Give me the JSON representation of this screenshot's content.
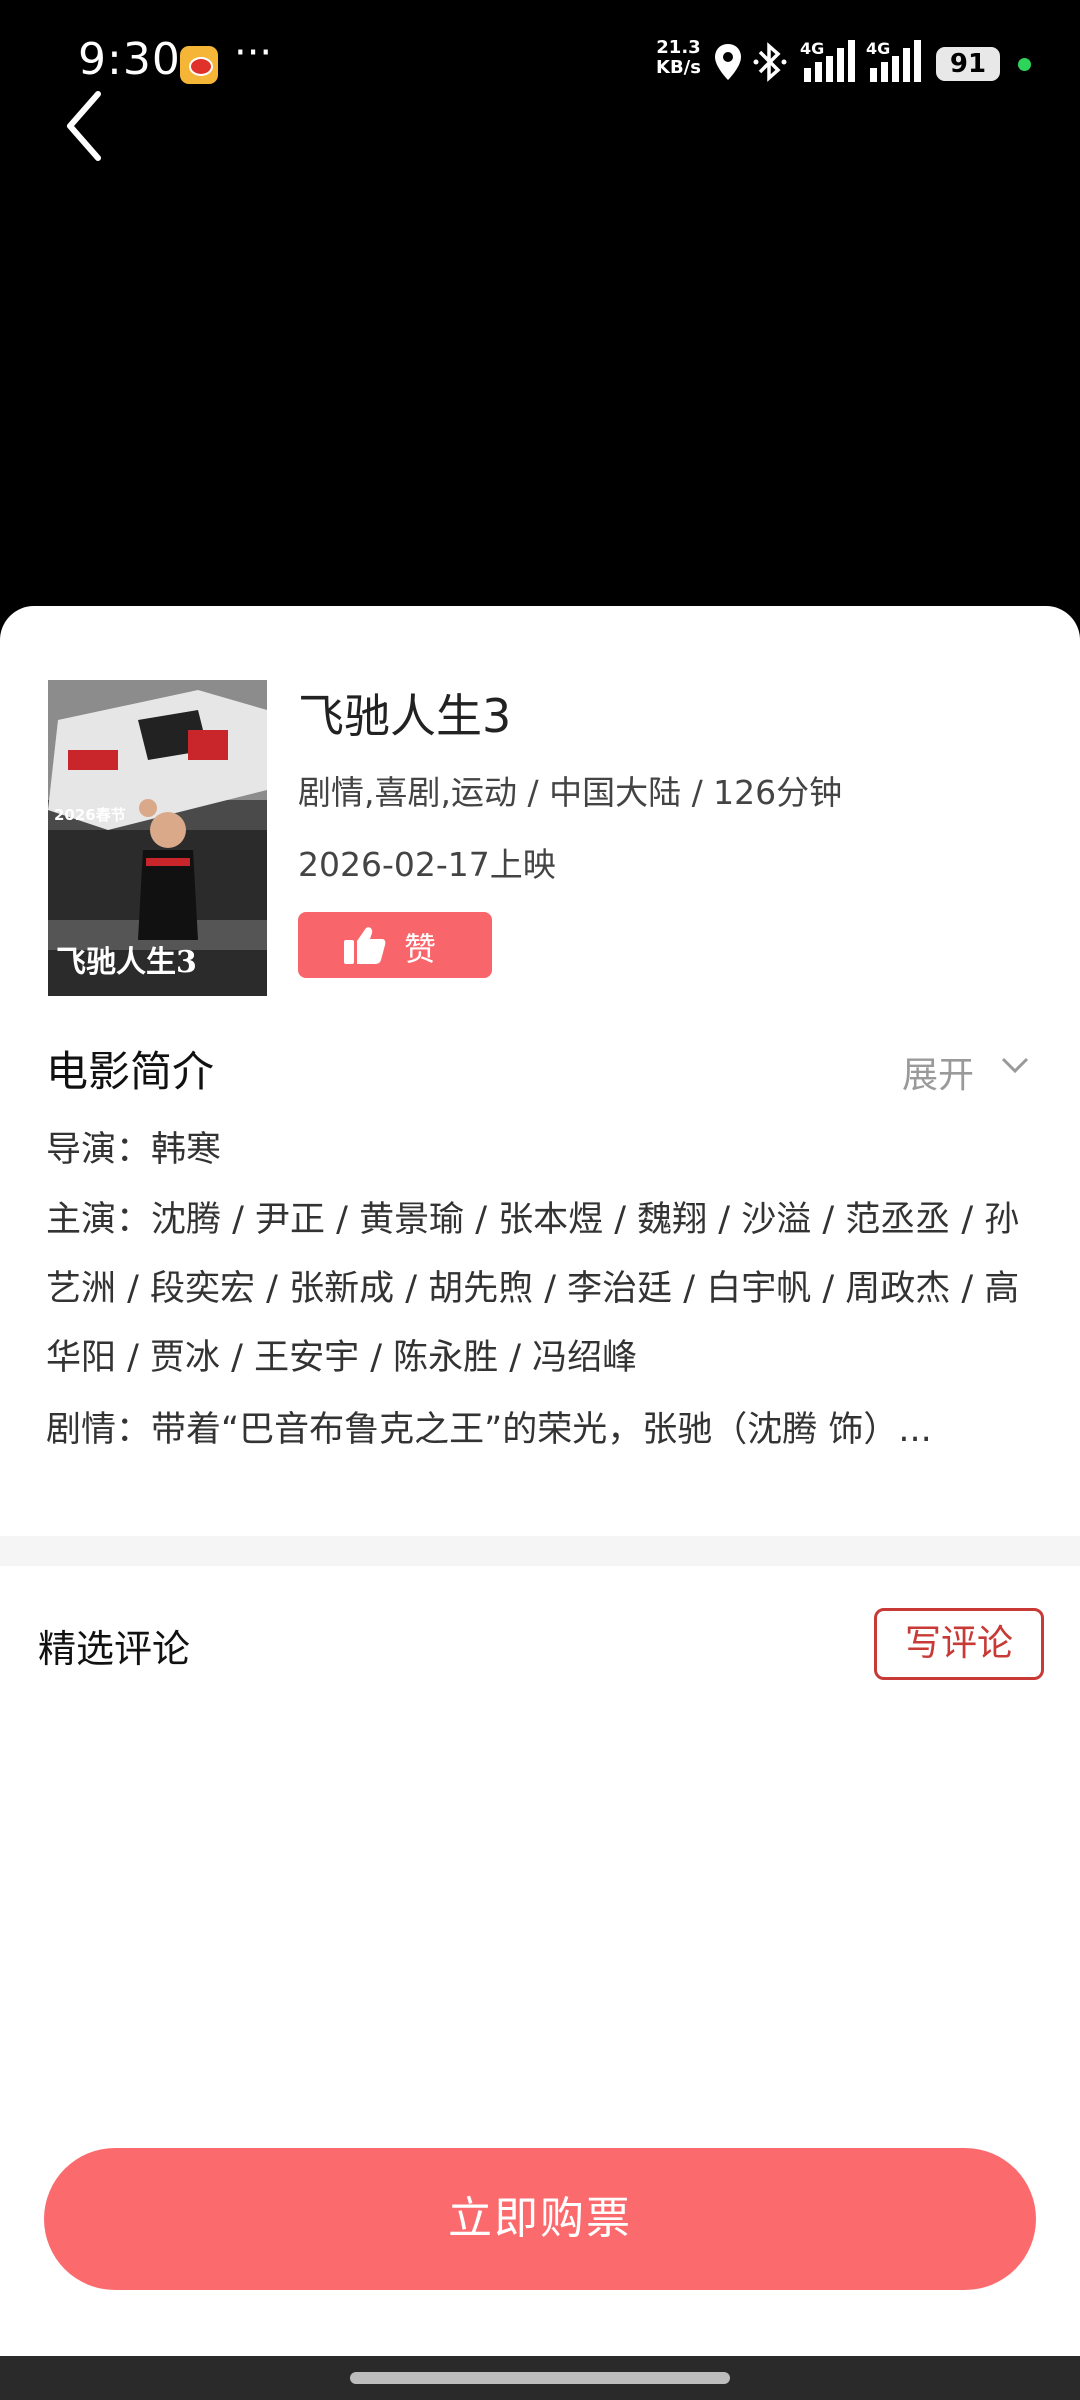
{
  "status_bar": {
    "time": "9:30",
    "dots": "···",
    "speed_value": "21.3",
    "speed_unit": "KB/s",
    "network_1": "4G",
    "network_2": "4G",
    "battery": "91"
  },
  "movie": {
    "title": "飞驰人生3",
    "meta": "剧情,喜剧,运动 / 中国大陆 / 126分钟",
    "release": "2026-02-17上映",
    "like_label": "赞",
    "poster_year": "2026春节",
    "poster_title": "飞驰人生3"
  },
  "intro": {
    "title": "电影简介",
    "expand_label": "展开",
    "director": "导演：韩寒",
    "cast": "主演：沈腾 / 尹正 / 黄景瑜 / 张本煜 / 魏翔 / 沙溢 / 范丞丞 / 孙艺洲 / 段奕宏 / 张新成 / 胡先煦 / 李治廷 / 白宇帆 / 周政杰 / 高华阳 / 贾冰 / 王安宇 / 陈永胜 / 冯绍峰",
    "plot": "剧情：带着“巴音布鲁克之王”的荣光，张驰（沈腾 饰）..."
  },
  "comments": {
    "title": "精选评论",
    "write_label": "写评论"
  },
  "buy_label": "立即购票",
  "colors": {
    "accent": "#fb6b6e",
    "like": "#f8656a",
    "write_border": "#c83a36"
  }
}
